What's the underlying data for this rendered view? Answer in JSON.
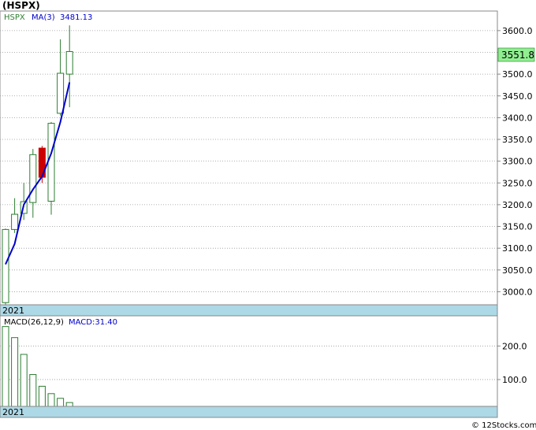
{
  "chart_data": [
    {
      "type": "candlestick",
      "title": "(HSPX)",
      "legend": {
        "symbol": "HSPX",
        "ma_label": "MA(3)",
        "ma_value": "3481.13"
      },
      "last_price_label": "3551.8",
      "last_price": 3551.8,
      "period_label": "2021",
      "ylim": [
        2970,
        3645
      ],
      "yticks": [
        "3000.0",
        "3050.0",
        "3100.0",
        "3150.0",
        "3200.0",
        "3250.0",
        "3300.0",
        "3350.0",
        "3400.0",
        "3450.0",
        "3500.0",
        "3550.0",
        "3600.0"
      ],
      "candles": [
        {
          "open": 2975,
          "high": 3145,
          "low": 2968,
          "close": 3143
        },
        {
          "open": 3143,
          "high": 3215,
          "low": 3135,
          "close": 3178
        },
        {
          "open": 3180,
          "high": 3250,
          "low": 3165,
          "close": 3207
        },
        {
          "open": 3205,
          "high": 3328,
          "low": 3170,
          "close": 3315
        },
        {
          "open": 3330,
          "high": 3335,
          "low": 3250,
          "close": 3263
        },
        {
          "open": 3208,
          "high": 3390,
          "low": 3177,
          "close": 3387
        },
        {
          "open": 3410,
          "high": 3580,
          "low": 3405,
          "close": 3502
        },
        {
          "open": 3500,
          "high": 3612,
          "low": 3424,
          "close": 3551.8
        }
      ],
      "ma": [
        3063,
        3110,
        3200,
        3235,
        3265,
        3318,
        3390,
        3481.13
      ],
      "colors": {
        "up": "#2e7d32",
        "down": "#cc0000",
        "ma": "#0000cc",
        "label_bg": "#90ee90"
      }
    },
    {
      "type": "bar",
      "title": "MACD(26,12,9)",
      "legend_value": "MACD:31.40",
      "period_label": "2021",
      "ylim": [
        20,
        290
      ],
      "yticks": [
        "100.0",
        "200.0"
      ],
      "values": [
        258,
        225,
        175,
        115,
        80,
        58,
        44,
        31.4
      ],
      "colors": {
        "bar": "#2e7d32"
      }
    }
  ],
  "footer": {
    "copyright": "© 12Stocks.com"
  }
}
